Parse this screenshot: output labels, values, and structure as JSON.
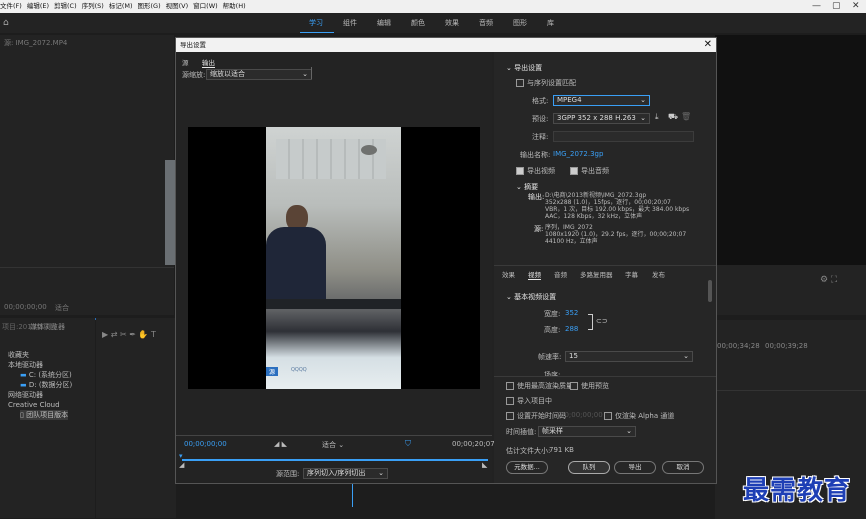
{
  "menubar": {
    "items": [
      "文件(F)",
      "编辑(E)",
      "剪辑(C)",
      "序列(S)",
      "标记(M)",
      "图形(G)",
      "视图(V)",
      "窗口(W)",
      "帮助(H)"
    ],
    "minimize": "—",
    "restore": "▢",
    "close": "✕"
  },
  "workspaces": [
    "学习",
    "组件",
    "编辑",
    "颜色",
    "效果",
    "音频",
    "图形",
    "库"
  ],
  "bg": {
    "source_label": "源: IMG_2072.MP4",
    "timecode_left": "00;00;00;00",
    "fit_left": "适合",
    "project_title": "项目:2013新项目",
    "media_browser": "媒体浏览器",
    "tree": [
      "收藏夹",
      "本地驱动器",
      "C: (系统分区)",
      "D: (数据分区)",
      "网络驱动器",
      "Creative Cloud",
      "团队项目版本"
    ],
    "ruler_1": "00;00;34;28",
    "ruler_2": "00;00;39;28"
  },
  "dialog": {
    "title": "导出设置",
    "close": "✕",
    "left_tabs": [
      "源",
      "输出"
    ],
    "source_scaling_label": "源缩放:",
    "source_scaling_value": "缩放以适合",
    "tc_in": "00;00;00;00",
    "fit": "适合",
    "tc_out": "00;00;20;07",
    "source_range_label": "源范围:",
    "source_range_value": "序列切入/序列切出",
    "export_settings_header": "导出设置",
    "match_sequence": "与序列设置匹配",
    "format_label": "格式:",
    "format_value": "MPEG4",
    "preset_label": "预设:",
    "preset_value": "3GPP 352 x 288 H.263",
    "comments_label": "注释:",
    "output_name_label": "输出名称:",
    "output_name_value": "IMG_2072.3gp",
    "export_video": "导出视频",
    "export_audio": "导出音频",
    "summary_header": "摘要",
    "summary_output_label": "输出:",
    "summary_output_lines": [
      "D:\\电商\\2013新视频\\IMG_2072.3gp",
      "352x288 (1.0)，15fps，逐行，00;00;20;07",
      "VBR，1 次，目标 192.00 kbps，最大 384.00 kbps",
      "AAC，128 Kbps，32 kHz，立体声"
    ],
    "summary_source_label": "源:",
    "summary_source_lines": [
      "序列，IMG_2072",
      "1080x1920 (1.0)，29.2 fps，逐行，00;00;20;07",
      "44100 Hz，立体声"
    ],
    "right_tabs": [
      "效果",
      "视频",
      "音频",
      "多路复用器",
      "字幕",
      "发布"
    ],
    "basic_video_header": "基本视频设置",
    "width_label": "宽度:",
    "width_value": "352",
    "height_label": "高度:",
    "height_value": "288",
    "frame_rate_label": "帧速率:",
    "frame_rate_value": "15",
    "field_order_label": "场序:",
    "use_max_render": "使用最高渲染质量",
    "use_previews": "使用预览",
    "import_into_project": "导入项目中",
    "set_start_timecode": "设置开始时间码",
    "start_timecode_value": "00;00;00;00",
    "render_alpha": "仅渲染 Alpha 通道",
    "time_interp_label": "时间插值:",
    "time_interp_value": "帧采样",
    "est_file_size_label": "估计文件大小:",
    "est_file_size_value": "791 KB",
    "btn_metadata": "元数据...",
    "btn_queue": "队列",
    "btn_export": "导出",
    "btn_cancel": "取消"
  },
  "preview_overlay_text": [
    "源",
    "QQQQ"
  ],
  "watermark": "最需教育",
  "colors": {
    "accent": "#3a9ff5",
    "dialog_bg": "#222222",
    "titlebar": "#f2f2f2"
  }
}
